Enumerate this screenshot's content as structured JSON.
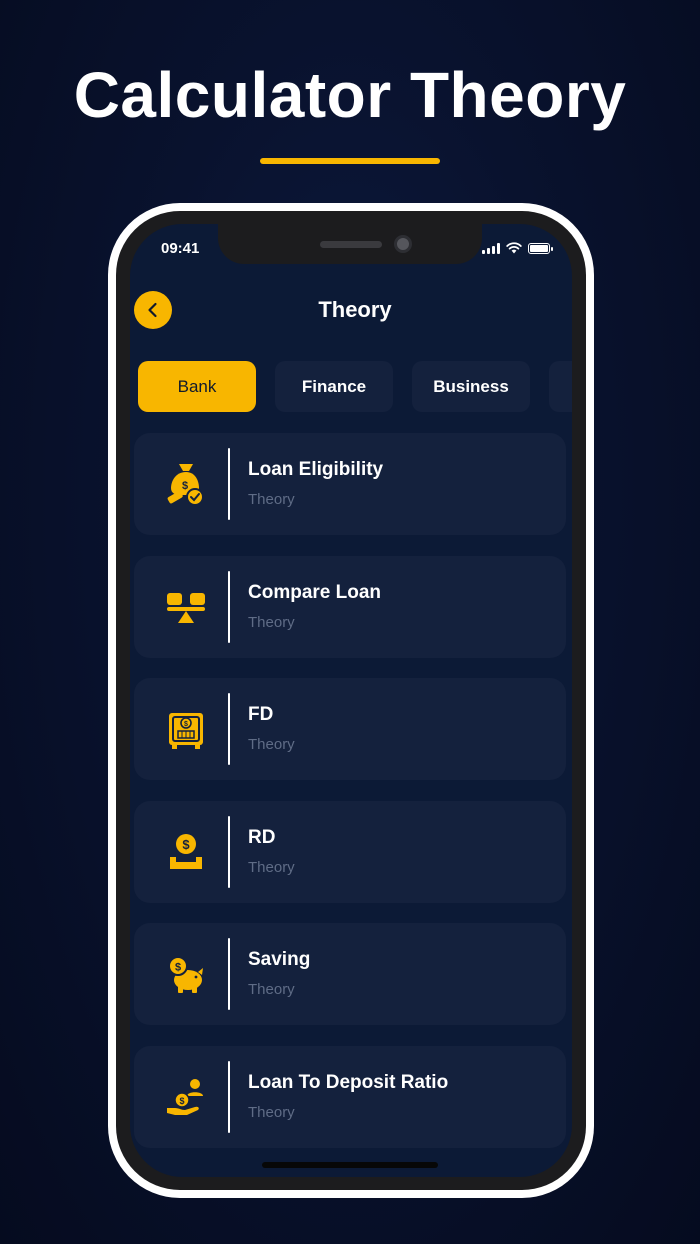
{
  "promo": {
    "title": "Calculator Theory",
    "accent_color": "#f8b600"
  },
  "status_bar": {
    "time": "09:41",
    "icons": [
      "signal-icon",
      "wifi-icon",
      "battery-icon"
    ]
  },
  "header": {
    "title": "Theory",
    "back_icon": "chevron-left-icon"
  },
  "tabs": [
    {
      "label": "Bank",
      "active": true
    },
    {
      "label": "Finance",
      "active": false
    },
    {
      "label": "Business",
      "active": false
    }
  ],
  "items": [
    {
      "title": "Loan Eligibility",
      "subtitle": "Theory",
      "icon": "money-bag-check-icon"
    },
    {
      "title": "Compare Loan",
      "subtitle": "Theory",
      "icon": "balance-scale-icon"
    },
    {
      "title": "FD",
      "subtitle": "Theory",
      "icon": "safe-deposit-icon"
    },
    {
      "title": "RD",
      "subtitle": "Theory",
      "icon": "coin-deposit-icon"
    },
    {
      "title": "Saving",
      "subtitle": "Theory",
      "icon": "piggy-bank-icon"
    },
    {
      "title": "Loan To Deposit Ratio",
      "subtitle": "Theory",
      "icon": "hand-coin-user-icon"
    }
  ],
  "colors": {
    "background": "#09122e",
    "screen": "#0c1a36",
    "card": "#14213d",
    "accent": "#f8b600",
    "subtitle": "#5f6c86"
  }
}
